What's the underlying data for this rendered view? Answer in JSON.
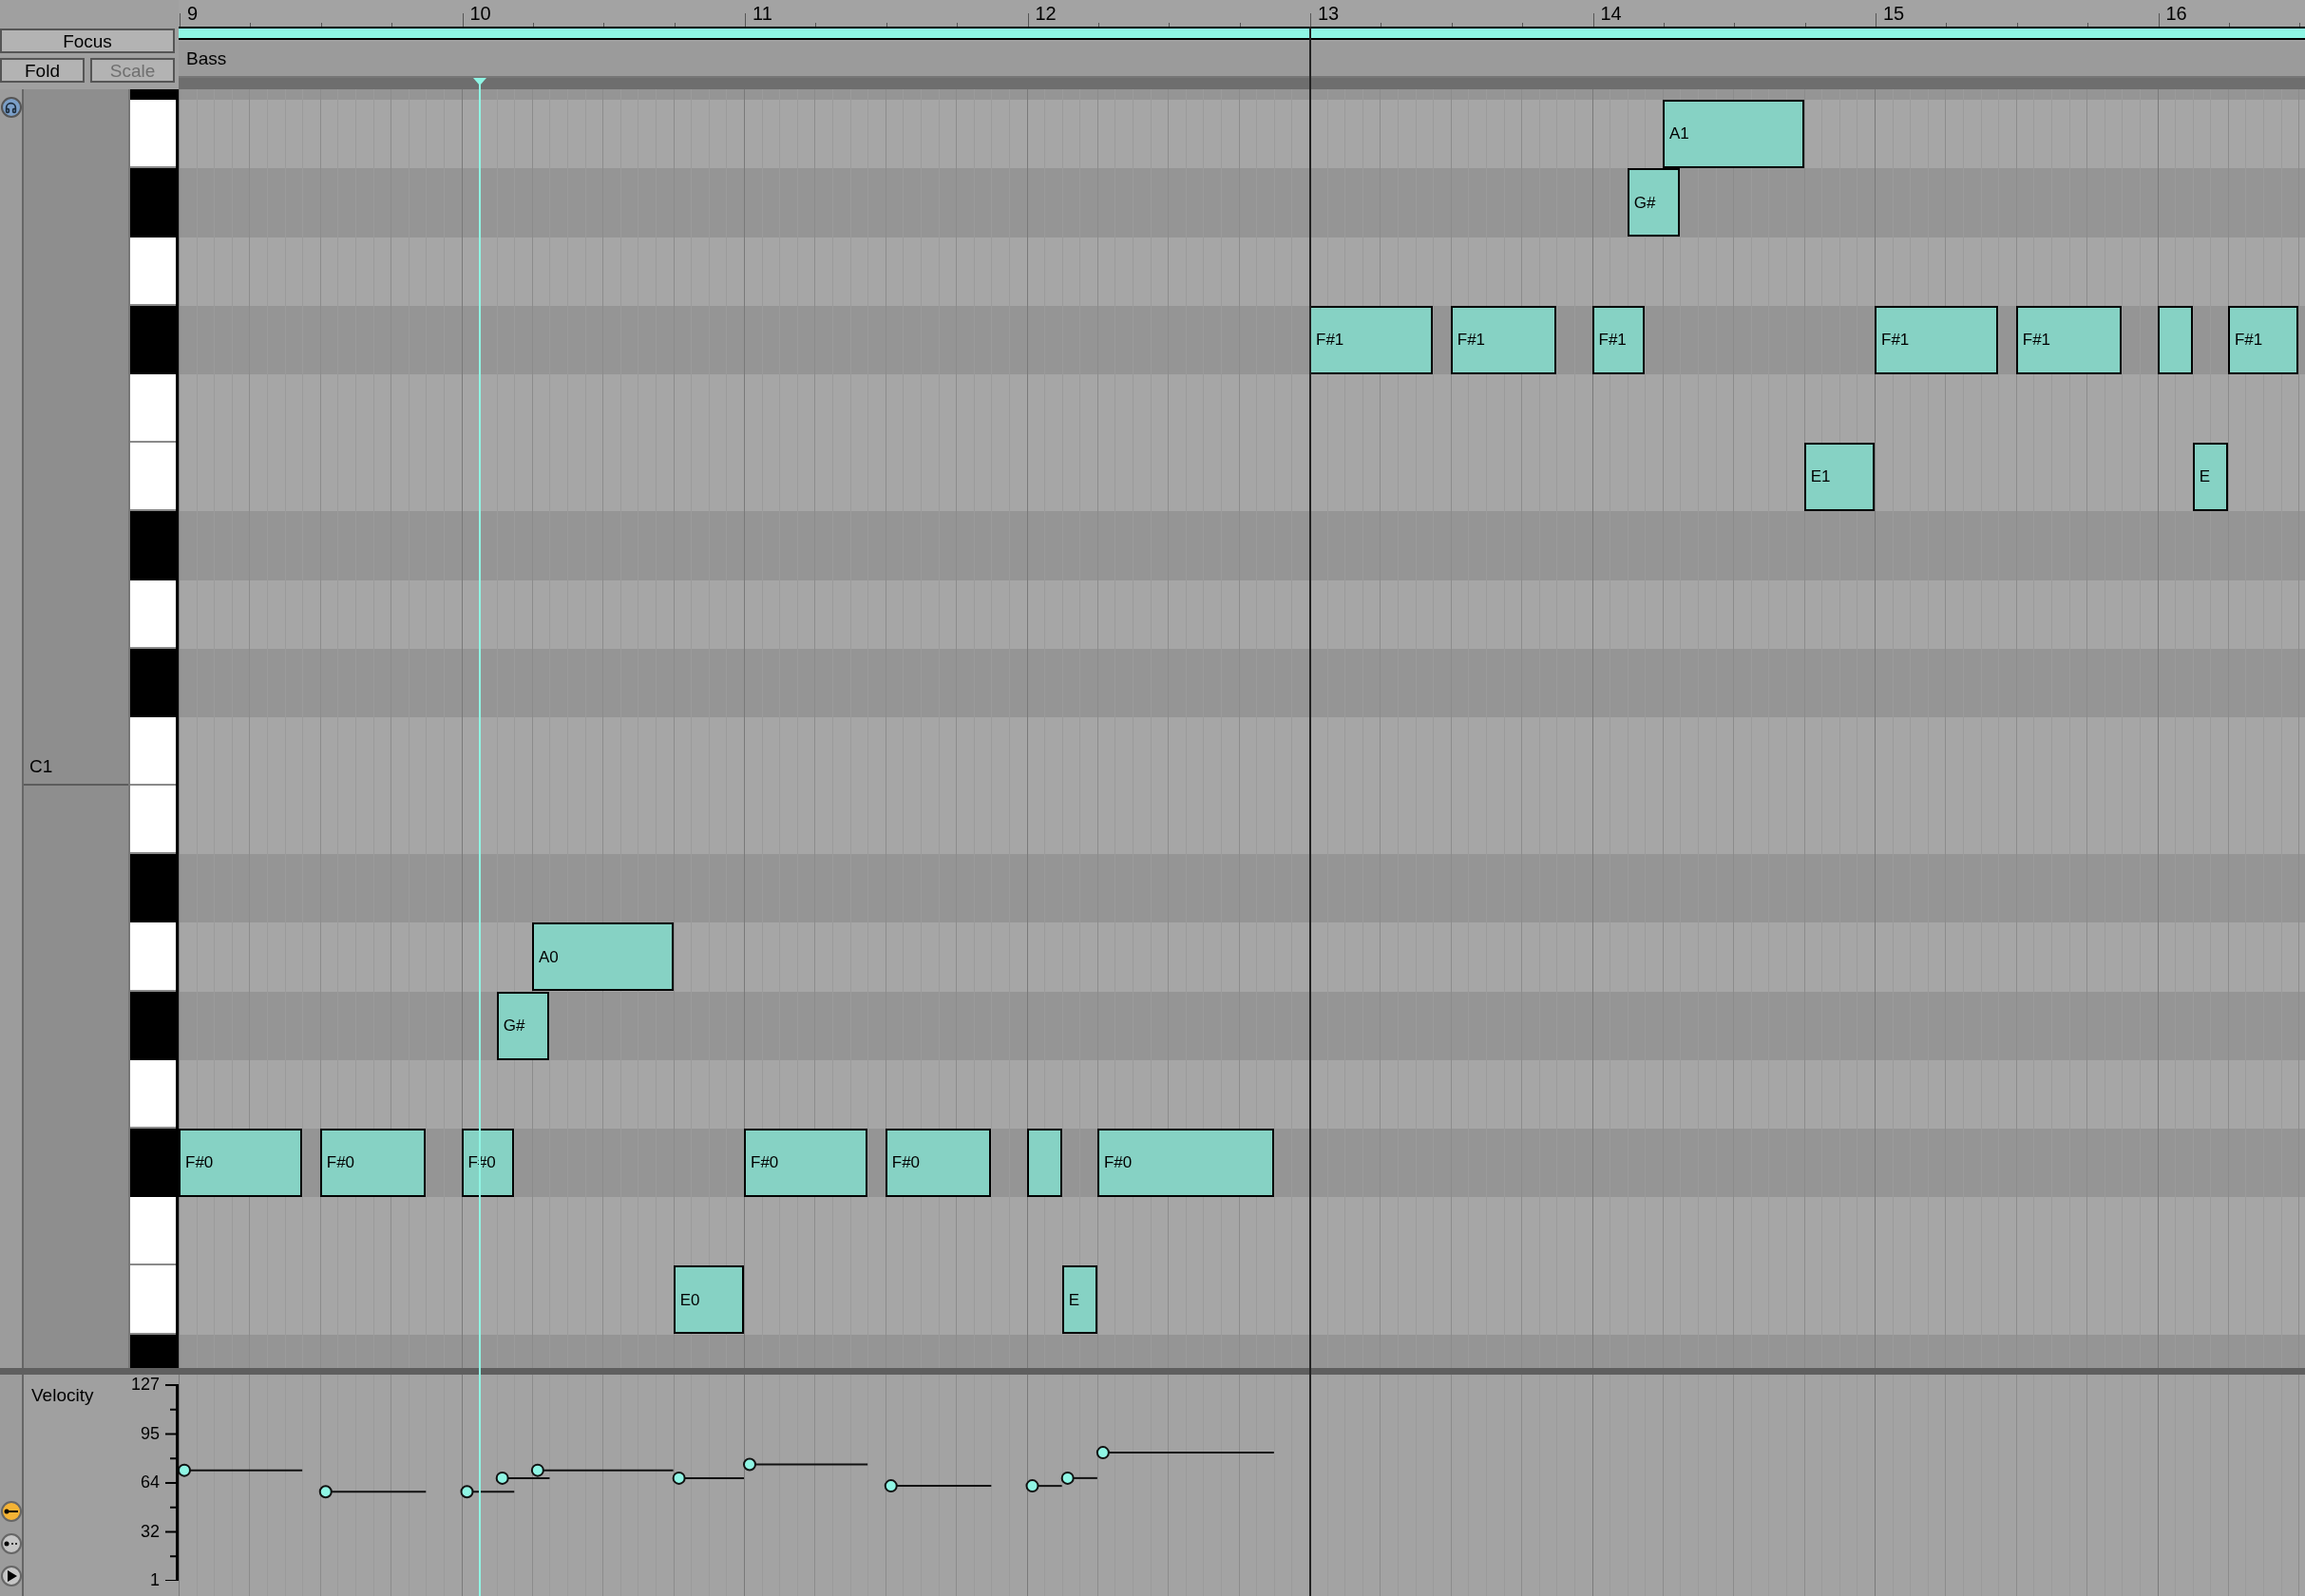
{
  "controls": {
    "buttons": [
      {
        "label": "Focus",
        "disabled": false
      },
      {
        "label": "Fold",
        "disabled": false
      },
      {
        "label": "Scale",
        "disabled": true
      }
    ]
  },
  "ruler": {
    "bars": [
      "9",
      "10",
      "11",
      "12",
      "13",
      "14",
      "15",
      "16"
    ]
  },
  "clip": {
    "name": "Bass"
  },
  "keys": [
    {
      "kind": "black"
    },
    {
      "kind": "white",
      "notes": [
        {
          "kind": "labeled",
          "label": "A1"
        }
      ]
    },
    {
      "kind": "black",
      "notes": [
        {
          "kind": "labeled",
          "label": "G#"
        }
      ]
    },
    {
      "kind": "white"
    },
    {
      "kind": "black",
      "notes": [
        {
          "kind": "labeled",
          "label": "F#1"
        },
        {
          "kind": "labeled",
          "label": "F#1"
        },
        {
          "kind": "labeled",
          "label": "F#1"
        },
        {
          "kind": "labeled",
          "label": "F#1"
        },
        {
          "kind": "labeled",
          "label": "F#1"
        },
        {
          "kind": "blank"
        },
        {
          "kind": "labeled",
          "label": "F#1"
        }
      ]
    },
    {
      "kind": "white"
    },
    {
      "kind": "white",
      "notes": [
        {
          "kind": "labeled",
          "label": "E1"
        },
        {
          "kind": "labeled",
          "label": "E"
        }
      ]
    },
    {
      "kind": "black"
    },
    {
      "kind": "white"
    },
    {
      "kind": "black"
    },
    {
      "kind": "white",
      "label": "C1"
    },
    {
      "kind": "white"
    },
    {
      "kind": "black"
    },
    {
      "kind": "white",
      "notes": [
        {
          "kind": "labeled",
          "label": "A0"
        }
      ]
    },
    {
      "kind": "black",
      "notes": [
        {
          "kind": "labeled",
          "label": "G#"
        }
      ]
    },
    {
      "kind": "white"
    },
    {
      "kind": "black",
      "notes": [
        {
          "kind": "labeled",
          "label": "F#0"
        },
        {
          "kind": "labeled",
          "label": "F#0"
        },
        {
          "kind": "labeled",
          "label": "F#0"
        },
        {
          "kind": "labeled",
          "label": "F#0"
        },
        {
          "kind": "labeled",
          "label": "F#0"
        },
        {
          "kind": "blank"
        },
        {
          "kind": "labeled",
          "label": "F#0"
        }
      ]
    },
    {
      "kind": "white"
    },
    {
      "kind": "white",
      "notes": [
        {
          "kind": "labeled",
          "label": "E0"
        },
        {
          "kind": "labeled",
          "label": "E"
        }
      ]
    },
    {
      "kind": "black"
    }
  ],
  "velocity_lane": {
    "title": "Velocity",
    "ticks": [
      "127",
      "95",
      "64",
      "32",
      "1"
    ]
  },
  "lane_tools": [
    {
      "kind": "draw",
      "selected": true
    },
    {
      "kind": "points",
      "selected": false
    },
    {
      "kind": "play",
      "selected": false
    }
  ]
}
